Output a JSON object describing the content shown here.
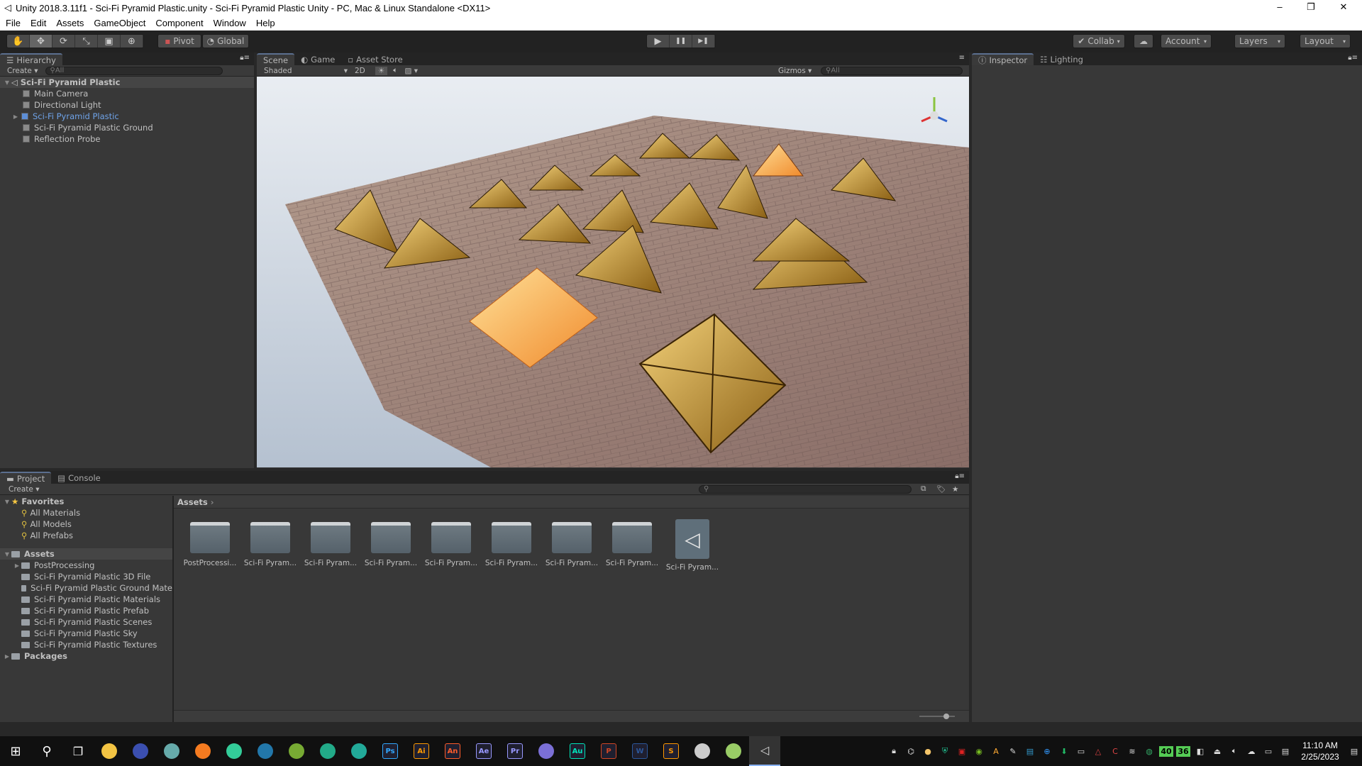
{
  "window": {
    "title": "Unity 2018.3.11f1 - Sci-Fi Pyramid Plastic.unity - Sci-Fi Pyramid Plastic Unity - PC, Mac & Linux Standalone <DX11>",
    "minimize": "–",
    "maximize": "❐",
    "close": "✕"
  },
  "menu": [
    "File",
    "Edit",
    "Assets",
    "GameObject",
    "Component",
    "Window",
    "Help"
  ],
  "toolbar": {
    "tools": [
      "hand-tool",
      "move-tool",
      "rotate-tool",
      "scale-tool",
      "rect-tool",
      "transform-tool"
    ],
    "pivot": "Pivot",
    "global": "Global",
    "play": "▶",
    "pause": "❚❚",
    "step": "▶❚",
    "collab": "Collab",
    "account": "Account",
    "layers": "Layers",
    "layout": "Layout"
  },
  "hierarchy": {
    "tab": "Hierarchy",
    "create": "Create",
    "search_placeholder": "All",
    "scene": "Sci-Fi Pyramid Plastic",
    "items": [
      {
        "label": "Main Camera",
        "selected": false
      },
      {
        "label": "Directional Light",
        "selected": false
      },
      {
        "label": "Sci-Fi Pyramid Plastic",
        "selected": true
      },
      {
        "label": "Sci-Fi Pyramid Plastic Ground",
        "selected": false
      },
      {
        "label": "Reflection Probe",
        "selected": false
      }
    ]
  },
  "scene": {
    "tabs": [
      "Scene",
      "Game",
      "Asset Store"
    ],
    "shading": "Shaded",
    "mode_2d": "2D",
    "gizmos": "Gizmos",
    "search_placeholder": "All"
  },
  "inspector": {
    "tabs": [
      "Inspector",
      "Lighting"
    ]
  },
  "project": {
    "tabs": [
      "Project",
      "Console"
    ],
    "create": "Create",
    "favorites": {
      "label": "Favorites",
      "items": [
        "All Materials",
        "All Models",
        "All Prefabs"
      ]
    },
    "assets": {
      "label": "Assets",
      "items": [
        "PostProcessing",
        "Sci-Fi Pyramid Plastic 3D File",
        "Sci-Fi Pyramid Plastic Ground Mate",
        "Sci-Fi Pyramid Plastic Materials",
        "Sci-Fi Pyramid Plastic Prefab",
        "Sci-Fi Pyramid Plastic Scenes",
        "Sci-Fi Pyramid Plastic Sky",
        "Sci-Fi Pyramid Plastic Textures"
      ]
    },
    "packages": "Packages",
    "breadcrumb": "Assets",
    "grid": [
      {
        "label": "PostProcessi...",
        "type": "folder"
      },
      {
        "label": "Sci-Fi Pyram...",
        "type": "folder"
      },
      {
        "label": "Sci-Fi Pyram...",
        "type": "folder"
      },
      {
        "label": "Sci-Fi Pyram...",
        "type": "folder"
      },
      {
        "label": "Sci-Fi Pyram...",
        "type": "folder"
      },
      {
        "label": "Sci-Fi Pyram...",
        "type": "folder"
      },
      {
        "label": "Sci-Fi Pyram...",
        "type": "folder"
      },
      {
        "label": "Sci-Fi Pyram...",
        "type": "folder"
      },
      {
        "label": "Sci-Fi Pyram...",
        "type": "unity-scene"
      }
    ]
  },
  "taskbar": {
    "apps": [
      {
        "name": "file-explorer",
        "glyph": "",
        "color": "#f3c443"
      },
      {
        "name": "app",
        "glyph": "",
        "color": "#3b4fb0"
      },
      {
        "name": "app",
        "glyph": "",
        "color": "#6aa"
      },
      {
        "name": "firefox",
        "glyph": "",
        "color": "#f57b20"
      },
      {
        "name": "chrome",
        "glyph": "",
        "color": "#3c9"
      },
      {
        "name": "app",
        "glyph": "",
        "color": "#27a"
      },
      {
        "name": "app",
        "glyph": "",
        "color": "#7a3"
      },
      {
        "name": "app",
        "glyph": "",
        "color": "#2a8"
      },
      {
        "name": "app",
        "glyph": "",
        "color": "#2a9"
      },
      {
        "name": "photoshop",
        "glyph": "Ps",
        "color": "#31a8ff"
      },
      {
        "name": "illustrator",
        "glyph": "Ai",
        "color": "#ff9a00"
      },
      {
        "name": "animate",
        "glyph": "An",
        "color": "#ff5c2b"
      },
      {
        "name": "after-effects",
        "glyph": "Ae",
        "color": "#9999ff"
      },
      {
        "name": "premiere",
        "glyph": "Pr",
        "color": "#9999ff"
      },
      {
        "name": "app",
        "glyph": "",
        "color": "#7b6fd6"
      },
      {
        "name": "audition",
        "glyph": "Au",
        "color": "#00e4bb"
      },
      {
        "name": "powerpoint",
        "glyph": "P",
        "color": "#d24726"
      },
      {
        "name": "word",
        "glyph": "W",
        "color": "#2b579a"
      },
      {
        "name": "sublime",
        "glyph": "S",
        "color": "#ff9800"
      },
      {
        "name": "app",
        "glyph": "",
        "color": "#ccc"
      },
      {
        "name": "app",
        "glyph": "",
        "color": "#9c6"
      },
      {
        "name": "unity",
        "glyph": "◁",
        "color": "#ddd"
      }
    ],
    "tray": [
      "40",
      "36"
    ],
    "time": "11:10 AM",
    "date": "2/25/2023"
  }
}
